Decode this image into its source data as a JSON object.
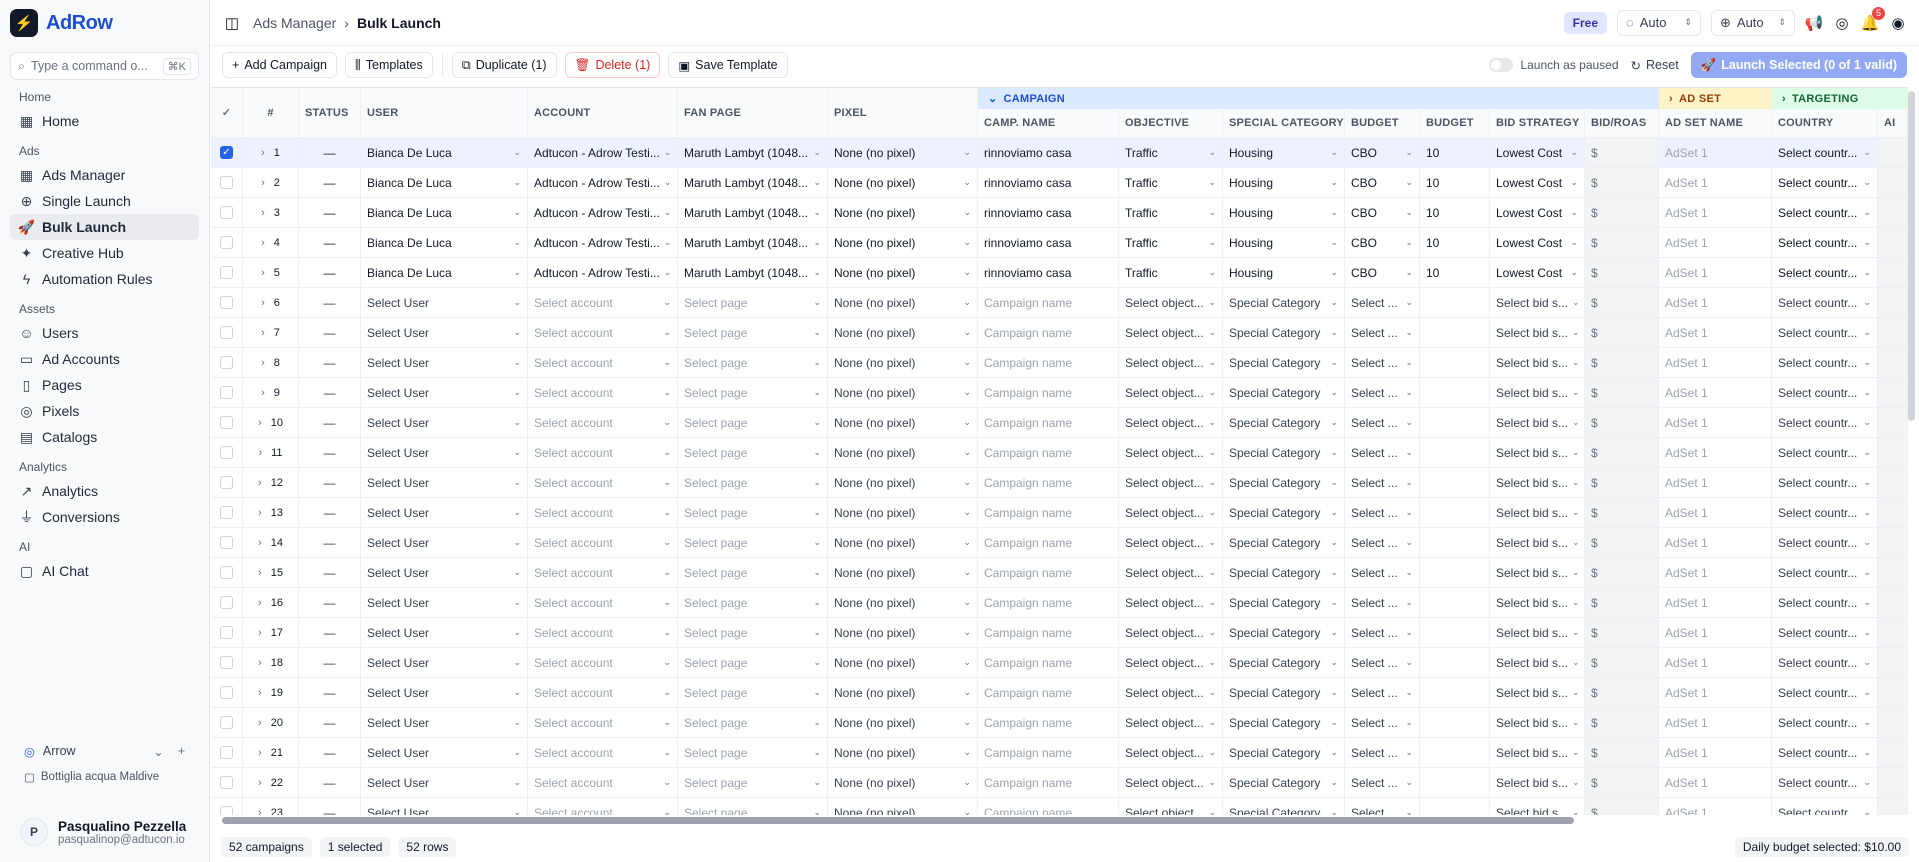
{
  "brand": {
    "name": "AdRow"
  },
  "command": {
    "placeholder": "Type a command o...",
    "shortcut": "⌘K"
  },
  "nav": [
    {
      "section": "Home",
      "items": [
        {
          "label": "Home",
          "icon": "grid-icon"
        }
      ]
    },
    {
      "section": "Ads",
      "items": [
        {
          "label": "Ads Manager",
          "icon": "grid-icon"
        },
        {
          "label": "Single Launch",
          "icon": "plus-circle-icon"
        },
        {
          "label": "Bulk Launch",
          "icon": "rocket-icon",
          "active": true
        },
        {
          "label": "Creative Hub",
          "icon": "sparkle-icon"
        },
        {
          "label": "Automation Rules",
          "icon": "zap-icon"
        }
      ]
    },
    {
      "section": "Assets",
      "items": [
        {
          "label": "Users",
          "icon": "users-icon"
        },
        {
          "label": "Ad Accounts",
          "icon": "wallet-icon"
        },
        {
          "label": "Pages",
          "icon": "file-icon"
        },
        {
          "label": "Pixels",
          "icon": "target-icon"
        },
        {
          "label": "Catalogs",
          "icon": "book-icon"
        }
      ]
    },
    {
      "section": "Analytics",
      "items": [
        {
          "label": "Analytics",
          "icon": "trend-icon"
        },
        {
          "label": "Conversions",
          "icon": "filter-icon"
        }
      ]
    },
    {
      "section": "AI",
      "items": [
        {
          "label": "AI Chat",
          "icon": "chat-icon"
        }
      ]
    }
  ],
  "workspace": {
    "name": "Arrow",
    "sub": "Bottiglia acqua Maldive"
  },
  "user": {
    "initial": "P",
    "name": "Pasqualino Pezzella",
    "email": "pasqualinop@adtucon.io"
  },
  "breadcrumb": {
    "parent": "Ads Manager",
    "current": "Bulk Launch"
  },
  "top": {
    "plan": "Free",
    "sel1": "Auto",
    "sel2": "Auto",
    "notifications": "5"
  },
  "toolbar": {
    "add": "Add Campaign",
    "templates": "Templates",
    "duplicate": "Duplicate (1)",
    "delete": "Delete (1)",
    "save_template": "Save Template",
    "paused": "Launch as paused",
    "reset": "Reset",
    "launch": "Launch Selected (0 of 1 valid)"
  },
  "groups": {
    "campaign": "CAMPAIGN",
    "adset": "AD SET",
    "targeting": "TARGETING"
  },
  "headers": {
    "num": "#",
    "status": "STATUS",
    "user": "USER",
    "account": "ACCOUNT",
    "page": "FAN PAGE",
    "pixel": "PIXEL",
    "cname": "CAMP. NAME",
    "objective": "OBJECTIVE",
    "special": "SPECIAL CATEGORY",
    "budget_type": "BUDGET",
    "budget": "BUDGET",
    "bid": "BID STRATEGY",
    "roas": "BID/ROAS",
    "adset_name": "AD SET NAME",
    "country": "COUNTRY",
    "more": "AI"
  },
  "filled_row": {
    "status": "—",
    "user": "Bianca De Luca",
    "account": "Adtucon - Adrow Testi...",
    "page": "Maruth Lambyt (1048...",
    "pixel": "None (no pixel)",
    "cname": "rinnoviamo casa",
    "objective": "Traffic",
    "special": "Housing",
    "budget_type": "CBO",
    "budget": "10",
    "bid": "Lowest Cost",
    "roas": "$",
    "adset": "AdSet 1",
    "country": "Select countr..."
  },
  "empty_row": {
    "status": "—",
    "user": "Select User",
    "account": "Select account",
    "page": "Select page",
    "pixel": "None (no pixel)",
    "cname": "Campaign name",
    "objective": "Select object...",
    "special": "Special Category",
    "budget_type": "Select ...",
    "roas": "$",
    "bid": "Select bid s...",
    "adset": "AdSet 1",
    "country": "Select countr..."
  },
  "filled_count": 5,
  "visible_rows": 23,
  "selected_row": 1,
  "footer": {
    "campaigns": "52 campaigns",
    "selected": "1 selected",
    "rows": "52 rows",
    "daily": "Daily budget selected: $10.00"
  }
}
